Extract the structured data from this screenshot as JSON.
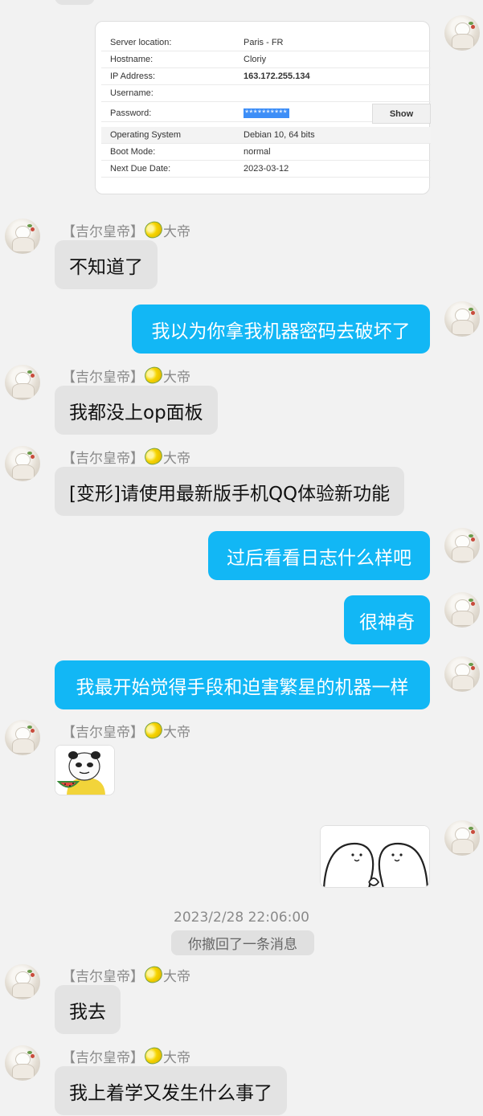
{
  "chat": {
    "sender_name": "【吉尔皇帝】",
    "sender_suffix": "大帝",
    "server_card": {
      "rows": [
        {
          "label": "Server location:",
          "value": "Paris - FR"
        },
        {
          "label": "Hostname:",
          "value": "Cloriy"
        },
        {
          "label": "IP Address:",
          "value": "163.172.255.134"
        },
        {
          "label": "Username:",
          "value": ""
        },
        {
          "label": "Password:",
          "value": "**********"
        },
        {
          "label": "Operating System",
          "value": "Debian 10, 64 bits"
        },
        {
          "label": "Boot Mode:",
          "value": "normal"
        },
        {
          "label": "Next Due Date:",
          "value": "2023-03-12"
        }
      ],
      "show_button": "Show"
    },
    "messages": [
      {
        "text": "不知道了"
      },
      {
        "text": "我以为你拿我机器密码去破坏了"
      },
      {
        "text": "我都没上op面板"
      },
      {
        "text": "[变形]请使用最新版手机QQ体验新功能"
      },
      {
        "text": "过后看看日志什么样吧"
      },
      {
        "text": "很神奇"
      },
      {
        "text": "我最开始觉得手段和迫害繁星的机器一样"
      },
      {
        "text": "我去"
      },
      {
        "text": "我上着学又发生什么事了"
      }
    ],
    "timestamp": "2023/2/28 22:06:00",
    "recall_notice": "你撤回了一条消息"
  },
  "colors": {
    "incoming_bubble": "#e3e3e3",
    "outgoing_bubble": "#12b7f5",
    "background": "#f2f2f2"
  }
}
